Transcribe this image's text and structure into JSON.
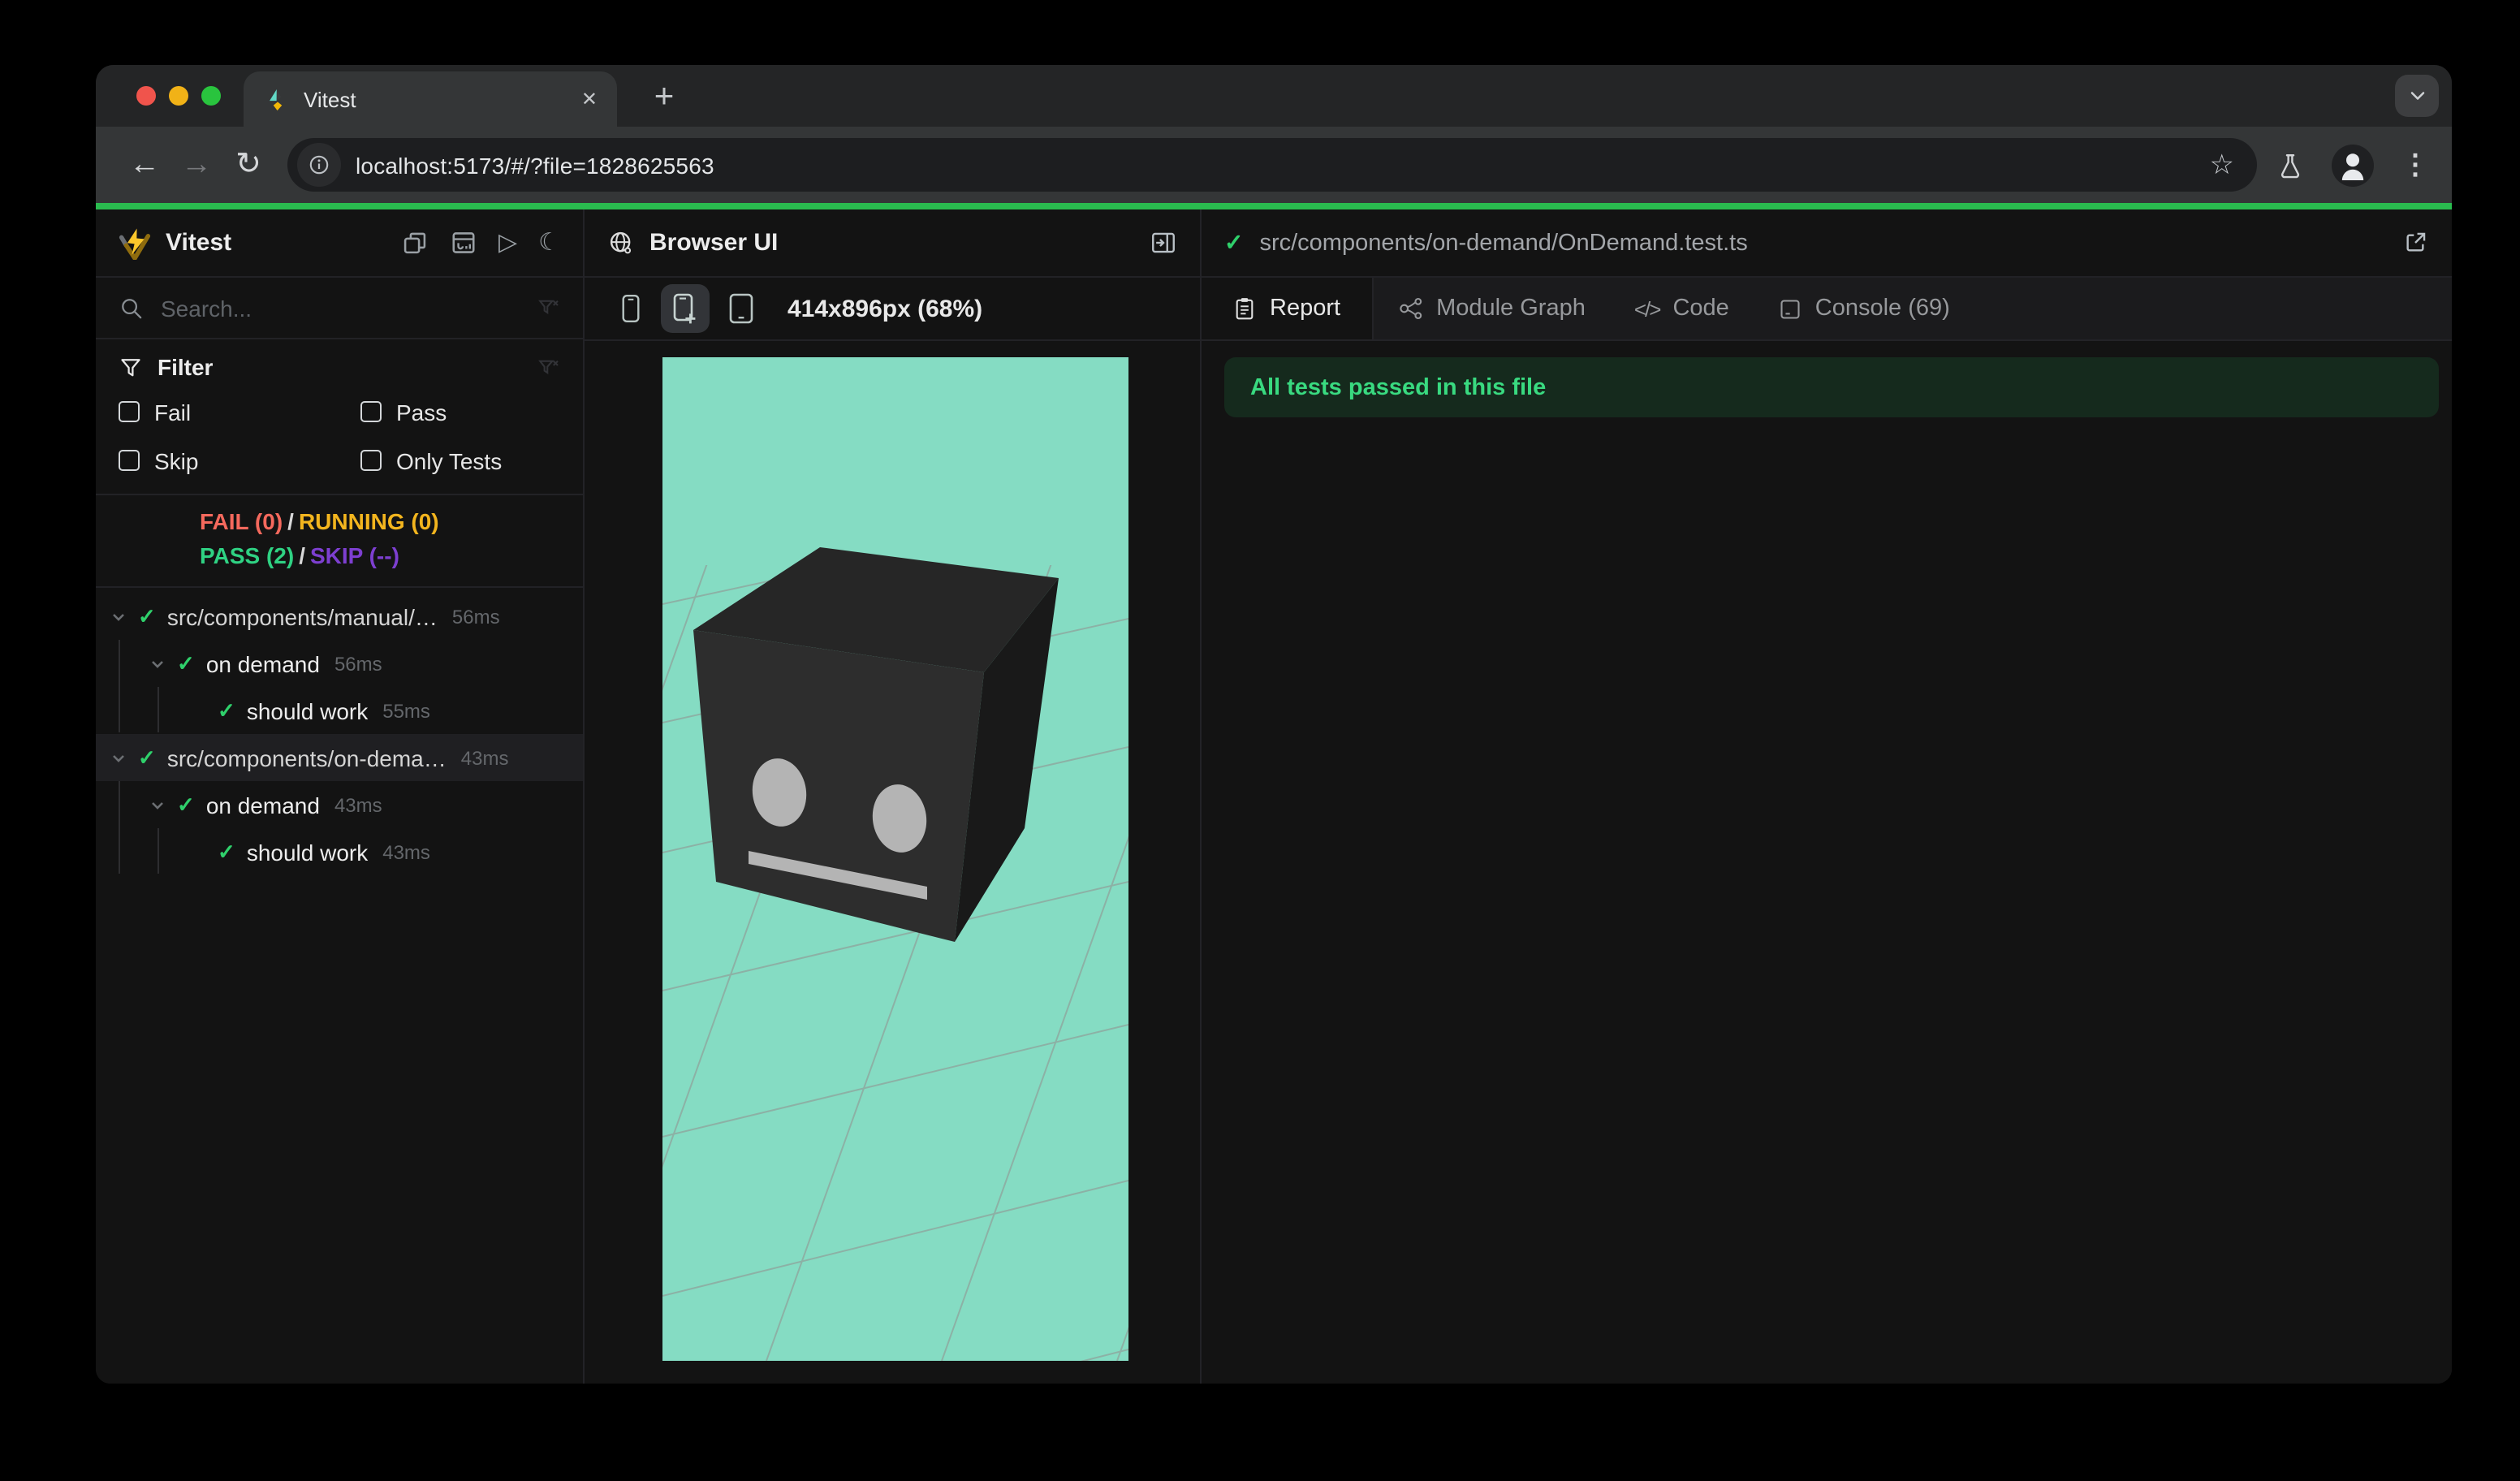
{
  "browser_chrome": {
    "tab_title": "Vitest",
    "url": "localhost:5173/#/?file=1828625563",
    "icons": {
      "back": "←",
      "forward": "→",
      "reload": "↻",
      "star": "☆",
      "menu": "⋮",
      "close_tab": "✕",
      "new_tab": "+"
    }
  },
  "sidebar": {
    "app_name": "Vitest",
    "header_icons": {
      "play": "▷",
      "moon": "☾"
    },
    "search_placeholder": "Search...",
    "filter": {
      "title": "Filter",
      "options": [
        "Fail",
        "Pass",
        "Skip",
        "Only Tests"
      ]
    },
    "status": {
      "fail": "FAIL (0)",
      "sep": "/",
      "running": "RUNNING (0)",
      "pass": "PASS (2)",
      "skip": "SKIP (--)"
    },
    "tree": [
      {
        "check": "✓",
        "label": "src/components/manual/…",
        "time": "56ms"
      },
      {
        "check": "✓",
        "label": "on demand",
        "time": "56ms"
      },
      {
        "check": "✓",
        "label": "should work",
        "time": "55ms"
      },
      {
        "check": "✓",
        "label": "src/components/on-dema…",
        "time": "43ms"
      },
      {
        "check": "✓",
        "label": "on demand",
        "time": "43ms"
      },
      {
        "check": "✓",
        "label": "should work",
        "time": "43ms"
      }
    ]
  },
  "browser_panel": {
    "title": "Browser UI",
    "viewport_size_label": "414x896px (68%)"
  },
  "report_panel": {
    "check": "✓",
    "file_path": "src/components/on-demand/OnDemand.test.ts",
    "tabs": [
      {
        "label": "Report",
        "active": true
      },
      {
        "label": "Module Graph",
        "active": false
      },
      {
        "label": "Code",
        "active": false,
        "icon": "</>"
      },
      {
        "label": "Console (69)",
        "active": false
      }
    ],
    "banner": "All tests passed in this file"
  },
  "colors": {
    "progress_green": "#2abb4f",
    "pass": "#2fd283",
    "fail": "#f5695d",
    "running": "#f3b51e",
    "skip": "#7d3fd0",
    "viewport_bg": "#85dcc3",
    "banner_bg": "#152a1d",
    "banner_text": "#39da80"
  }
}
